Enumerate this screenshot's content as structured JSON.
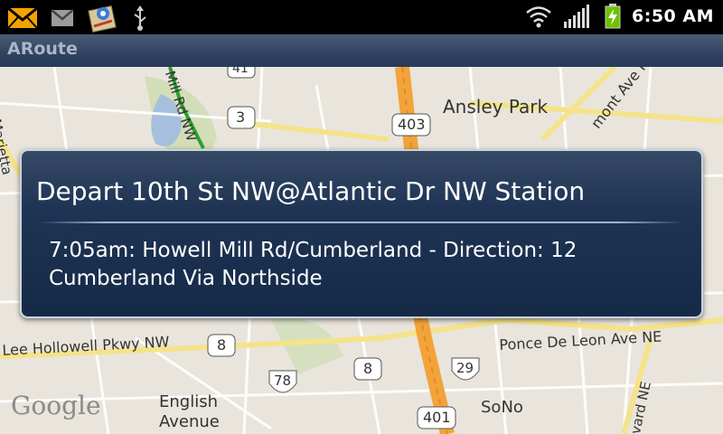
{
  "status_bar": {
    "time": "6:50 AM",
    "icons": [
      "mail-icon",
      "gmail-icon",
      "app-notification-icon",
      "usb-icon",
      "wifi-icon",
      "signal-icon",
      "battery-charging-icon"
    ]
  },
  "app": {
    "title": "ARoute"
  },
  "map": {
    "labels": {
      "ansley_park": "Ansley Park",
      "marietta": "Marietta",
      "mill_rd": "Mill Rd NW",
      "piedmont": "mont Ave NE",
      "lee_hollowell": "Lee Hollowell Pkwy NW",
      "ponce": "Ponce De Leon Ave NE",
      "english_avenue": "English Avenue",
      "sono": "SoNo",
      "ward": "vard NE",
      "google": "Google"
    },
    "shields": {
      "s41": "41",
      "s3": "3",
      "s403_top": "403",
      "s8_left": "8",
      "s8_mid": "8",
      "s78": "78",
      "s29": "29",
      "s401": "401"
    }
  },
  "dialog": {
    "title": "Depart 10th St NW@Atlantic Dr NW Station",
    "body": "7:05am: Howell Mill Rd/Cumberland - Direction: 12 Cumberland Via Northside"
  },
  "colors": {
    "dialog_bg": "#152a47",
    "titlebar_bg": "#2f4260",
    "route_green": "#2ea02e"
  }
}
